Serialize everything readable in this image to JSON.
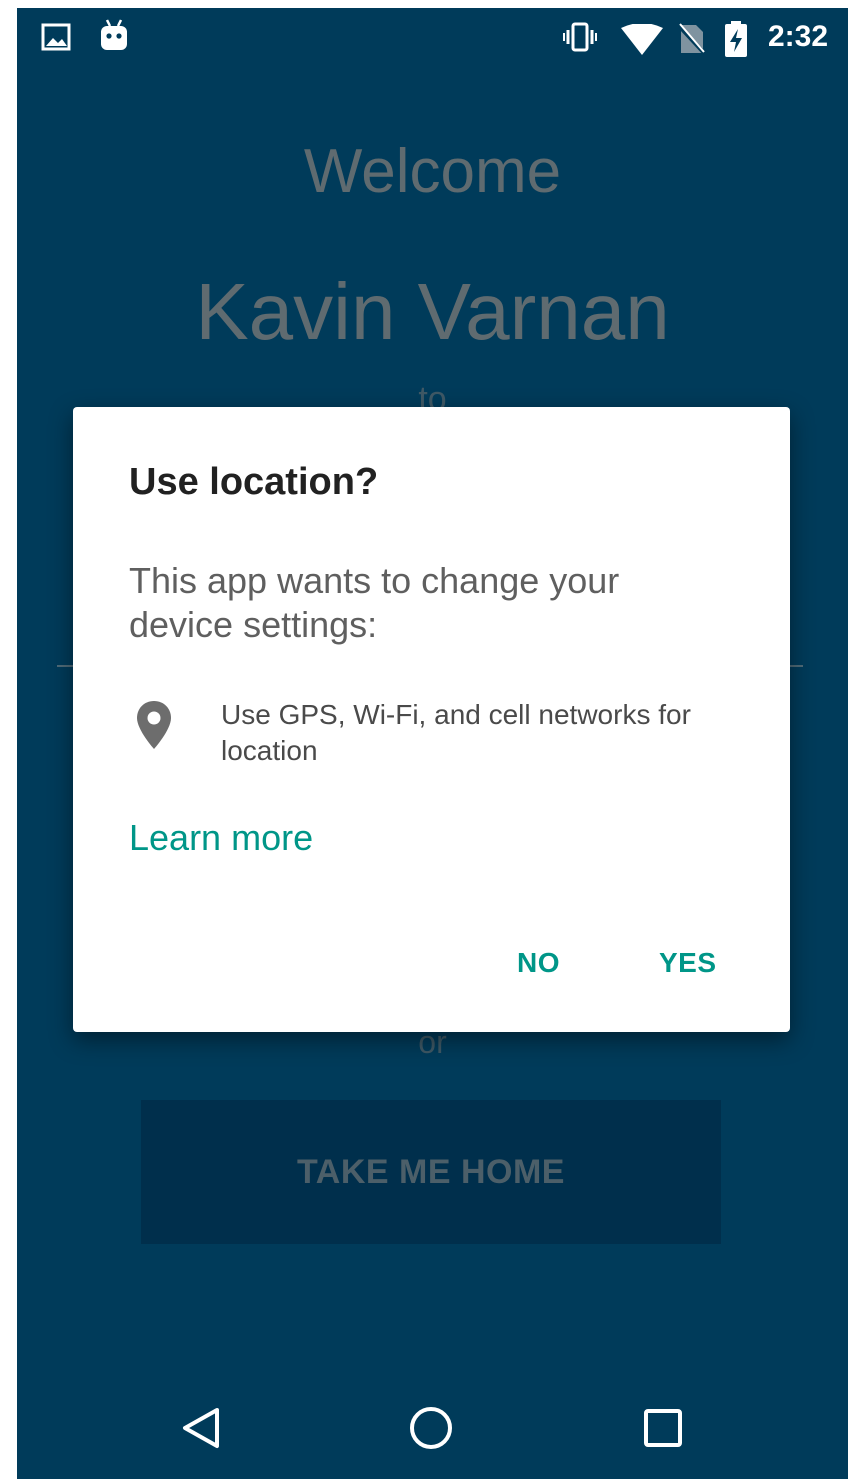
{
  "status_bar": {
    "time": "2:32",
    "icons": [
      "image-icon",
      "android-debug-icon",
      "vibrate-icon",
      "wifi-icon",
      "no-sim-icon",
      "battery-charging-icon"
    ]
  },
  "background": {
    "welcome": "Welcome",
    "user_name": "Kavin Varnan",
    "to": "to",
    "or": "or",
    "take_home_button": "TAKE ME HOME"
  },
  "dialog": {
    "title": "Use location?",
    "message": "This app wants to change your device settings:",
    "permission": {
      "icon": "location-pin-icon",
      "text": "Use GPS, Wi-Fi, and cell networks for location"
    },
    "learn_more": "Learn more",
    "no_button": "NO",
    "yes_button": "YES"
  },
  "nav_bar": {
    "buttons": [
      "back-icon",
      "home-icon",
      "recents-icon"
    ]
  },
  "colors": {
    "background": "#003b5a",
    "accent": "#009688",
    "dialog_bg": "#ffffff"
  }
}
